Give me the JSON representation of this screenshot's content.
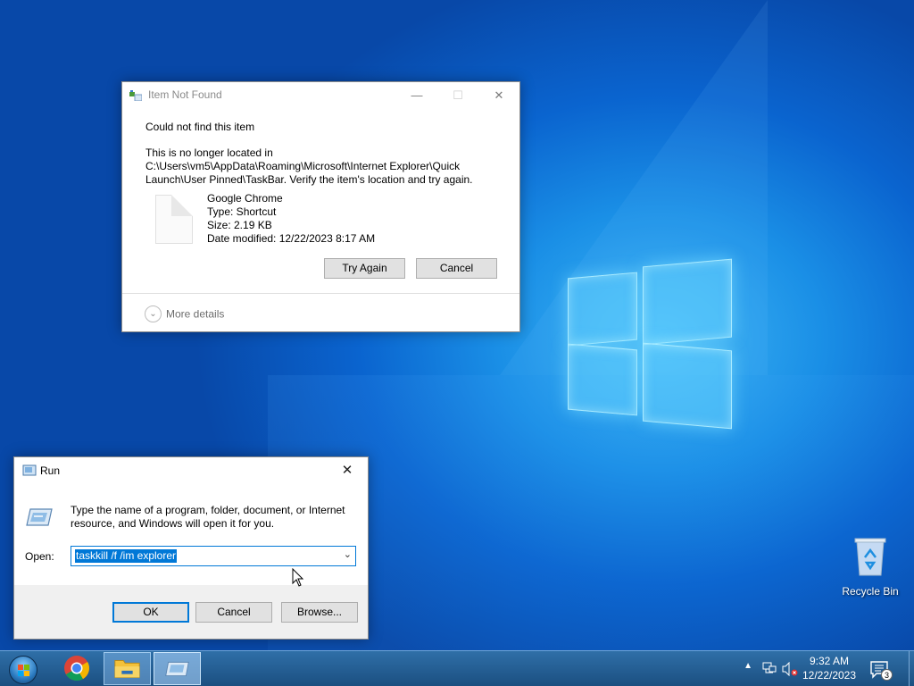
{
  "item_not_found": {
    "title": "Item Not Found",
    "heading": "Could not find this item",
    "description": "This is no longer located in C:\\Users\\vm5\\AppData\\Roaming\\Microsoft\\Internet Explorer\\Quick Launch\\User Pinned\\TaskBar. Verify the item's location and try again.",
    "file": {
      "name": "Google Chrome",
      "type": "Type: Shortcut",
      "size": "Size: 2.19 KB",
      "modified": "Date modified: 12/22/2023 8:17 AM"
    },
    "try_again_label": "Try Again",
    "cancel_label": "Cancel",
    "more_details_label": "More details"
  },
  "run_dialog": {
    "title": "Run",
    "message": "Type the name of a program, folder, document, or Internet resource, and Windows will open it for you.",
    "open_label": "Open:",
    "open_value": "taskkill /f /im explorer",
    "ok_label": "OK",
    "cancel_label": "Cancel",
    "browse_label": "Browse..."
  },
  "desktop": {
    "recycle_bin_label": "Recycle Bin"
  },
  "taskbar": {
    "time": "9:32 AM",
    "date": "12/22/2023",
    "notification_count": "3",
    "pinned": [
      "chrome-icon",
      "file-explorer-icon",
      "run-icon"
    ]
  },
  "colors": {
    "accent": "#0078d7",
    "taskbar": "#245d94",
    "desktop": "#0a64cf"
  }
}
